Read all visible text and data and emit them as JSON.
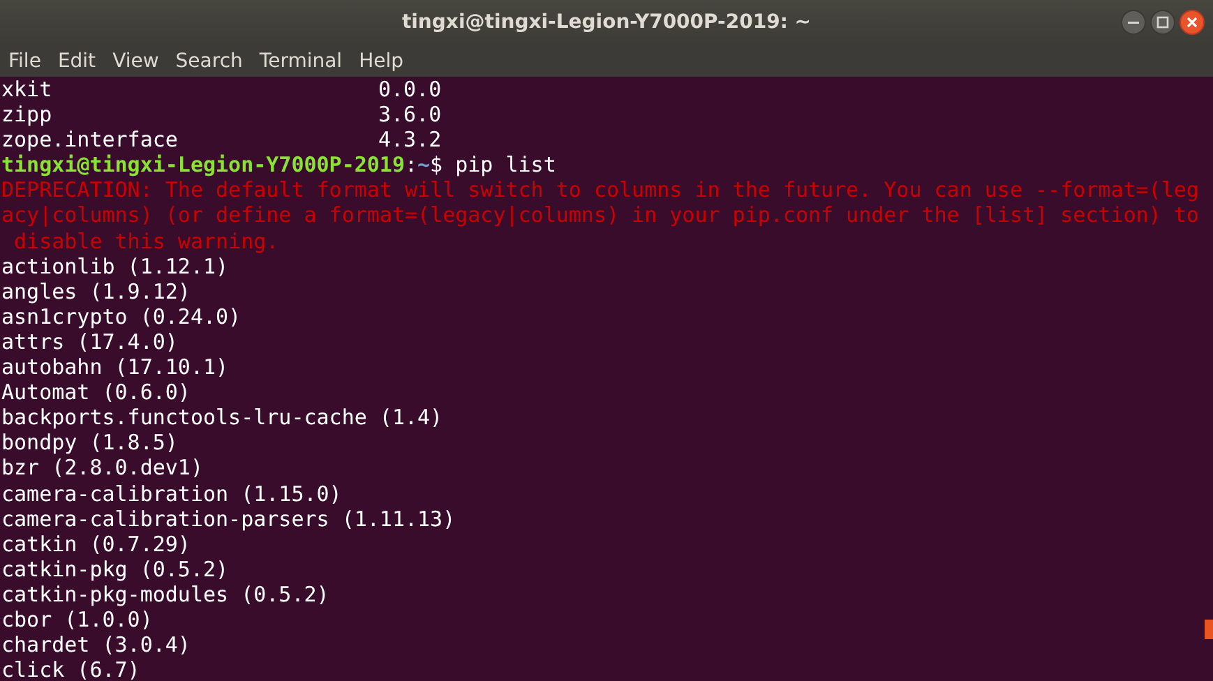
{
  "window": {
    "title": "tingxi@tingxi-Legion-Y7000P-2019: ~"
  },
  "menu": [
    "File",
    "Edit",
    "View",
    "Search",
    "Terminal",
    "Help"
  ],
  "terminal": {
    "lines": [
      {
        "kind": "columns",
        "name": "xkit",
        "version": "0.0.0"
      },
      {
        "kind": "columns",
        "name": "zipp",
        "version": "3.6.0"
      },
      {
        "kind": "columns",
        "name": "zope.interface",
        "version": "4.3.2"
      },
      {
        "kind": "prompt",
        "user": "tingxi@tingxi-Legion-Y7000P-2019",
        "separator": ":",
        "path": "~",
        "command": "$ pip list"
      },
      {
        "kind": "error",
        "text": "DEPRECATION: The default format will switch to columns in the future. You can use --format=(leg"
      },
      {
        "kind": "error",
        "text": "acy|columns) (or define a format=(legacy|columns) in your pip.conf under the [list] section) to"
      },
      {
        "kind": "error",
        "text": " disable this warning."
      },
      {
        "kind": "text",
        "text": "actionlib (1.12.1)"
      },
      {
        "kind": "text",
        "text": "angles (1.9.12)"
      },
      {
        "kind": "text",
        "text": "asn1crypto (0.24.0)"
      },
      {
        "kind": "text",
        "text": "attrs (17.4.0)"
      },
      {
        "kind": "text",
        "text": "autobahn (17.10.1)"
      },
      {
        "kind": "text",
        "text": "Automat (0.6.0)"
      },
      {
        "kind": "text",
        "text": "backports.functools-lru-cache (1.4)"
      },
      {
        "kind": "text",
        "text": "bondpy (1.8.5)"
      },
      {
        "kind": "text",
        "text": "bzr (2.8.0.dev1)"
      },
      {
        "kind": "text",
        "text": "camera-calibration (1.15.0)"
      },
      {
        "kind": "text",
        "text": "camera-calibration-parsers (1.11.13)"
      },
      {
        "kind": "text",
        "text": "catkin (0.7.29)"
      },
      {
        "kind": "text",
        "text": "catkin-pkg (0.5.2)"
      },
      {
        "kind": "text",
        "text": "catkin-pkg-modules (0.5.2)"
      },
      {
        "kind": "text",
        "text": "cbor (1.0.0)"
      },
      {
        "kind": "text",
        "text": "chardet (3.0.4)"
      },
      {
        "kind": "text",
        "text": "click (6.7)"
      }
    ]
  }
}
